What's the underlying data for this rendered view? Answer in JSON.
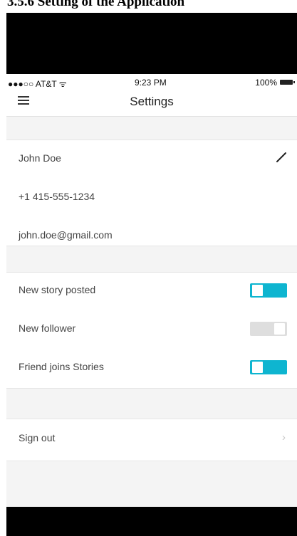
{
  "caption": "3.5.6 Setting of the Application",
  "status_bar": {
    "carrier": "●●●○○ AT&T ᯤ",
    "time": "9:23 PM",
    "battery": "100%"
  },
  "nav": {
    "title": "Settings",
    "menu_icon": "hamburger-menu-icon"
  },
  "profile": {
    "name": "John Doe",
    "phone": "+1 415-555-1234",
    "email": "john.doe@gmail.com",
    "edit_icon": "pencil-icon"
  },
  "notifications": [
    {
      "label": "New story posted",
      "enabled": true
    },
    {
      "label": "New follower",
      "enabled": false
    },
    {
      "label": "Friend joins Stories",
      "enabled": true
    }
  ],
  "account": {
    "sign_out": "Sign out",
    "chevron": "›"
  },
  "colors": {
    "toggle_on": "#0eb5d0",
    "toggle_off": "#dedede",
    "section_bg": "#f4f4f4"
  }
}
